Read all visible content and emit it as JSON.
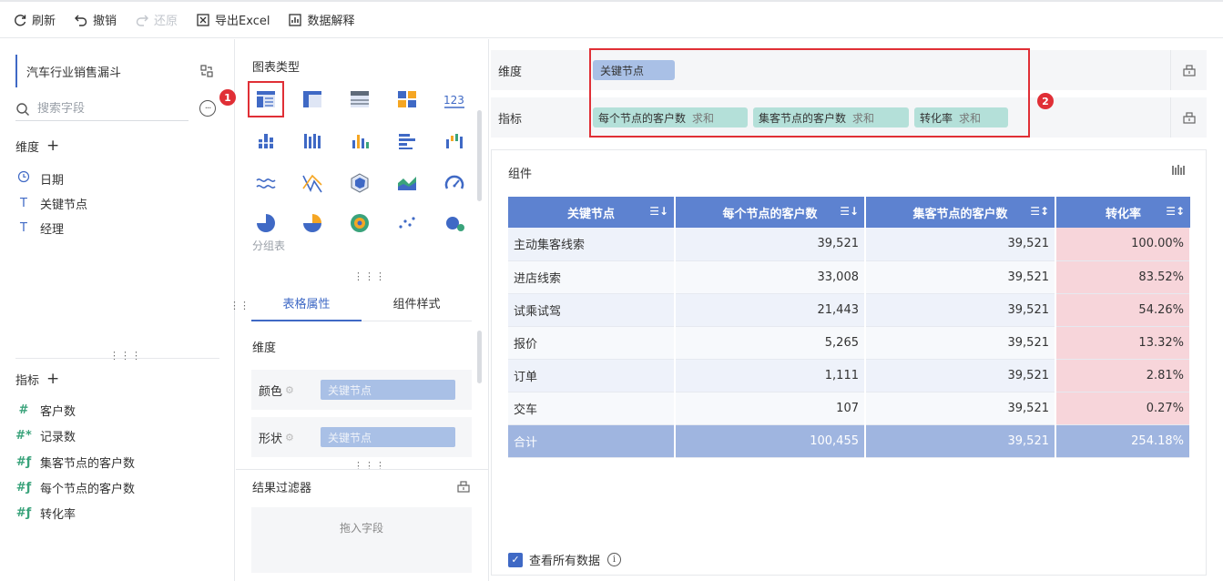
{
  "toolbar": {
    "refresh": "刷新",
    "undo": "撤销",
    "redo": "还原",
    "export_excel": "导出Excel",
    "data_explain": "数据解释"
  },
  "left": {
    "dataset_name": "汽车行业销售漏斗",
    "search_placeholder": "搜索字段",
    "dimensions_title": "维度",
    "dimensions": [
      {
        "label": "日期",
        "icon": "clock-icon"
      },
      {
        "label": "关键节点",
        "icon": "text-type-icon"
      },
      {
        "label": "经理",
        "icon": "text-type-icon"
      }
    ],
    "measures_title": "指标",
    "measures": [
      {
        "label": "客户数",
        "icon": "number-icon"
      },
      {
        "label": "记录数",
        "icon": "number-star-icon"
      },
      {
        "label": "集客节点的客户数",
        "icon": "calc-number-icon"
      },
      {
        "label": "每个节点的客户数",
        "icon": "calc-number-icon"
      },
      {
        "label": "转化率",
        "icon": "calc-number-icon"
      }
    ]
  },
  "middle": {
    "chart_type_title": "图表类型",
    "chart_type_caption": "分组表",
    "chart_type_badge": "1",
    "tabs": [
      "表格属性",
      "组件样式"
    ],
    "dimension_title": "维度",
    "color_label": "颜色",
    "shape_label": "形状",
    "color_value": "关键节点",
    "shape_value": "关键节点",
    "filter_title": "结果过滤器",
    "drop_hint": "拖入字段"
  },
  "right": {
    "dimension_label": "维度",
    "measure_label": "指标",
    "dimension_pill": "关键节点",
    "measure_pills": [
      {
        "name": "每个节点的客户数",
        "agg": "求和"
      },
      {
        "name": "集客节点的客户数",
        "agg": "求和"
      },
      {
        "name": "转化率",
        "agg": "求和"
      }
    ],
    "badge": "2",
    "component_title": "组件",
    "table": {
      "headers": [
        "关键节点",
        "每个节点的客户数",
        "集客节点的客户数",
        "转化率"
      ],
      "rows": [
        [
          "主动集客线索",
          "39,521",
          "39,521",
          "100.00%"
        ],
        [
          "进店线索",
          "33,008",
          "39,521",
          "83.52%"
        ],
        [
          "试乘试驾",
          "21,443",
          "39,521",
          "54.26%"
        ],
        [
          "报价",
          "5,265",
          "39,521",
          "13.32%"
        ],
        [
          "订单",
          "1,111",
          "39,521",
          "2.81%"
        ],
        [
          "交车",
          "107",
          "39,521",
          "0.27%"
        ]
      ],
      "total": [
        "合计",
        "100,455",
        "39,521",
        "254.18%"
      ]
    },
    "view_all_data": "查看所有数据"
  },
  "colors": {
    "accent": "#3f69c5",
    "header_blue": "#5d82d0",
    "highlight_red": "#e02f36",
    "rate_bg": "#f7d5da"
  }
}
